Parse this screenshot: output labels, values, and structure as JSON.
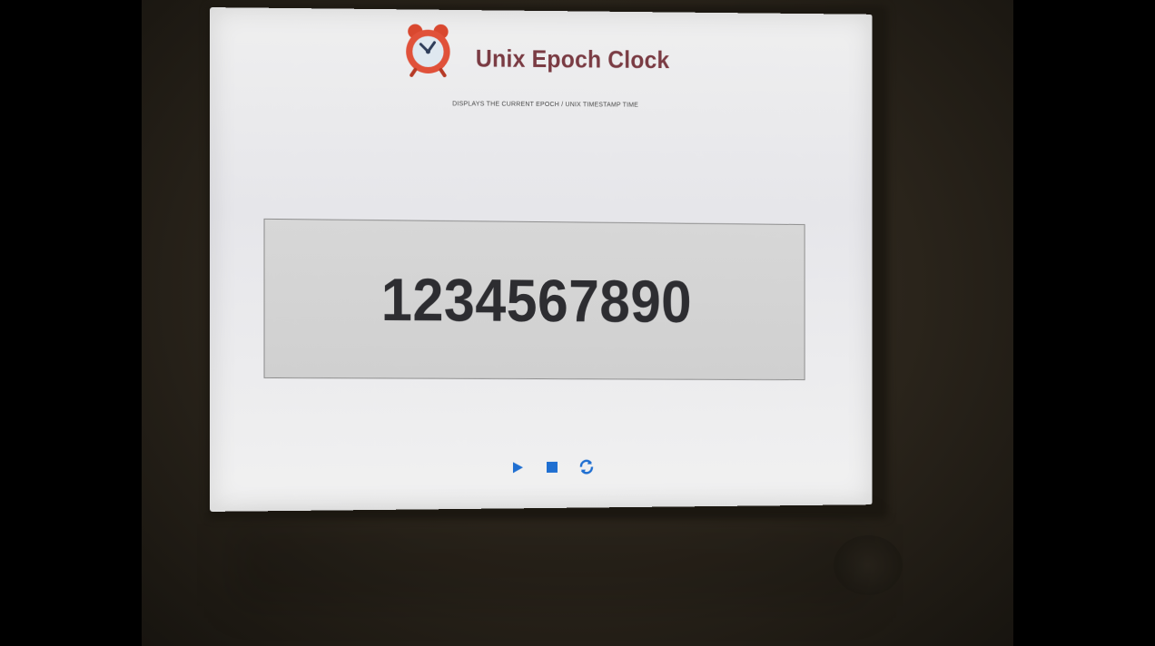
{
  "app": {
    "title": "Unix Epoch Clock",
    "subtitle": "DISPLAYS THE CURRENT EPOCH / UNIX TIMESTAMP TIME"
  },
  "clock": {
    "epoch_value": "1234567890"
  },
  "controls": [
    {
      "name": "play",
      "icon": "play-icon"
    },
    {
      "name": "stop",
      "icon": "stop-icon"
    },
    {
      "name": "refresh",
      "icon": "refresh-icon"
    }
  ],
  "colors": {
    "title": "#7a3b43",
    "accent": "#1f6fd1",
    "logo_red": "#e0513a"
  }
}
